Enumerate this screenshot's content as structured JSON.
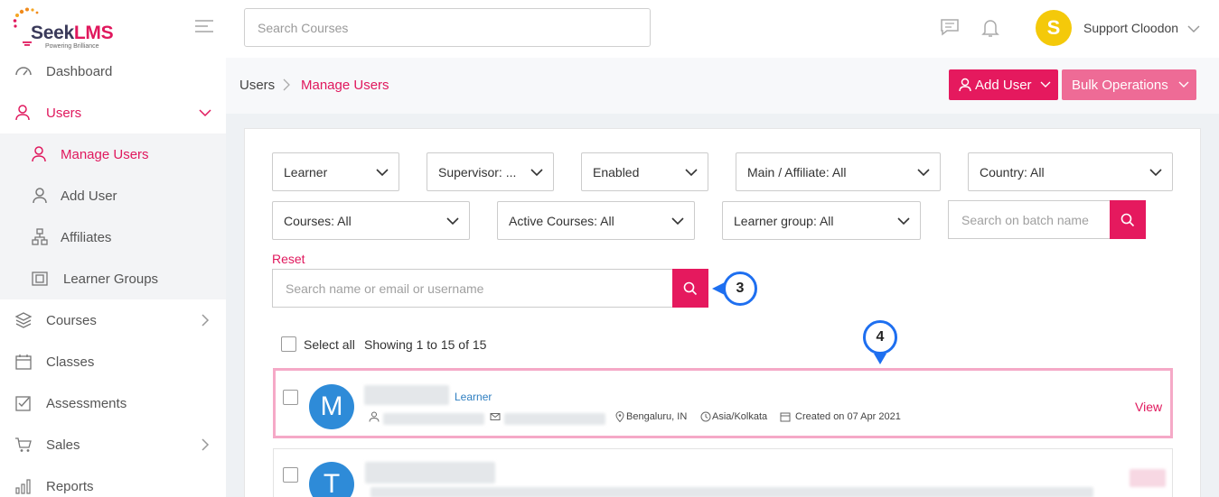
{
  "app": {
    "logo_name_a": "Seek",
    "logo_name_b": "LMS",
    "logo_tagline": "Powering Brilliance",
    "search_placeholder": "Search Courses",
    "user_initial": "S",
    "user_name": "Support Cloodon"
  },
  "sidebar": {
    "dashboard": "Dashboard",
    "users": "Users",
    "manage_users": "Manage Users",
    "add_user": "Add User",
    "affiliates": "Affiliates",
    "learner_groups": "Learner Groups",
    "courses": "Courses",
    "classes": "Classes",
    "assessments": "Assessments",
    "sales": "Sales",
    "reports": "Reports"
  },
  "breadcrumb": {
    "root": "Users",
    "current": "Manage Users"
  },
  "actions": {
    "add_user": "Add User",
    "bulk_operations": "Bulk Operations"
  },
  "filters": {
    "role": "Learner",
    "supervisor": "Supervisor: ...",
    "status": "Enabled",
    "affiliate": "Main / Affiliate: All",
    "country": "Country: All",
    "courses": "Courses: All",
    "active_courses": "Active Courses: All",
    "learner_group": "Learner group: All",
    "batch_placeholder": "Search on batch name",
    "reset": "Reset",
    "name_placeholder": "Search name or email or username"
  },
  "callouts": {
    "search": "3",
    "row": "4"
  },
  "list": {
    "select_all": "Select all",
    "showing": "Showing 1 to 15 of 15",
    "rows": [
      {
        "initial": "M",
        "role": "Learner",
        "location": "Bengaluru, IN",
        "timezone": "Asia/Kolkata",
        "created": "Created on 07 Apr 2021",
        "action": "View"
      },
      {
        "initial": "T"
      }
    ]
  },
  "colors": {
    "accent": "#e5195e",
    "accent_light": "#ee6b96",
    "callout": "#1e6ff0",
    "avatar_blue": "#2e8bd8",
    "avatar_yellow": "#f4c90a"
  }
}
